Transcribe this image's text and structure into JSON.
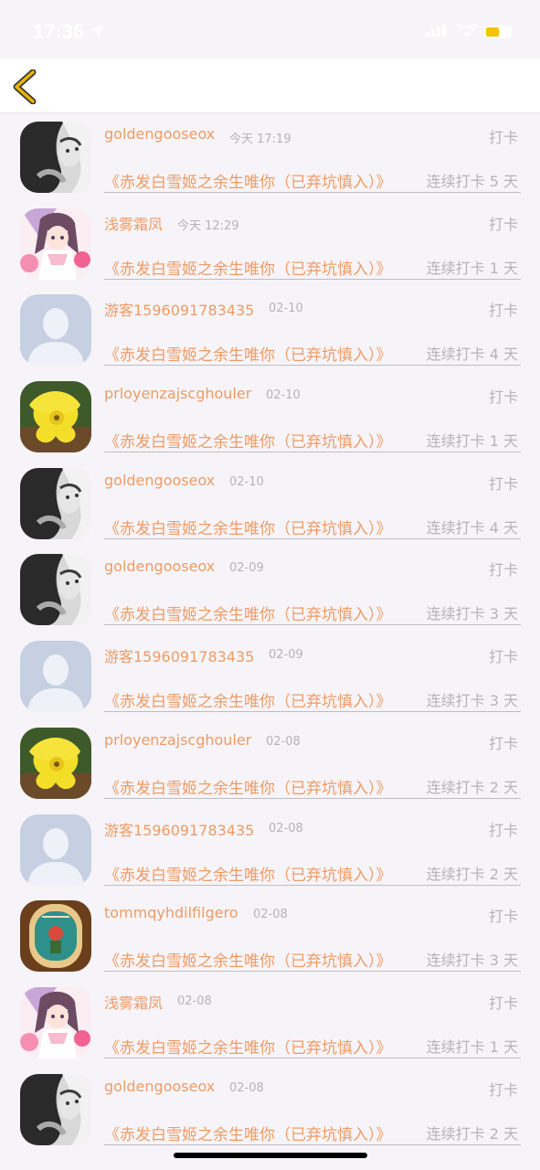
{
  "status_bar": {
    "time": "17:36"
  },
  "nav": {
    "back_icon": "chevron-left-icon",
    "accent_color": "#e8b400"
  },
  "colors": {
    "username": "#ee9b65",
    "meta": "#b4b4b8"
  },
  "entries": [
    {
      "username": "goldengooseox",
      "time": "今天 17:19",
      "action": "打卡",
      "book": "《赤发白雪姬之余生唯你（已弃坑慎入）》",
      "streak": "连续打卡 5 天",
      "avatar": "bw-girl"
    },
    {
      "username": "浅雾霜凤",
      "time": "今天 12:29",
      "action": "打卡",
      "book": "《赤发白雪姬之余生唯你（已弃坑慎入）》",
      "streak": "连续打卡 1 天",
      "avatar": "anime-girl"
    },
    {
      "username": "游客1596091783435",
      "time": "02-10",
      "action": "打卡",
      "book": "《赤发白雪姬之余生唯你（已弃坑慎入）》",
      "streak": "连续打卡 4 天",
      "avatar": "default-user"
    },
    {
      "username": "prloyenzajscghouler",
      "time": "02-10",
      "action": "打卡",
      "book": "《赤发白雪姬之余生唯你（已弃坑慎入）》",
      "streak": "连续打卡 1 天",
      "avatar": "yellow-flower"
    },
    {
      "username": "goldengooseox",
      "time": "02-10",
      "action": "打卡",
      "book": "《赤发白雪姬之余生唯你（已弃坑慎入）》",
      "streak": "连续打卡 4 天",
      "avatar": "bw-girl"
    },
    {
      "username": "goldengooseox",
      "time": "02-09",
      "action": "打卡",
      "book": "《赤发白雪姬之余生唯你（已弃坑慎入）》",
      "streak": "连续打卡 3 天",
      "avatar": "bw-girl"
    },
    {
      "username": "游客1596091783435",
      "time": "02-09",
      "action": "打卡",
      "book": "《赤发白雪姬之余生唯你（已弃坑慎入）》",
      "streak": "连续打卡 3 天",
      "avatar": "default-user"
    },
    {
      "username": "prloyenzajscghouler",
      "time": "02-08",
      "action": "打卡",
      "book": "《赤发白雪姬之余生唯你（已弃坑慎入）》",
      "streak": "连续打卡 2 天",
      "avatar": "yellow-flower"
    },
    {
      "username": "游客1596091783435",
      "time": "02-08",
      "action": "打卡",
      "book": "《赤发白雪姬之余生唯你（已弃坑慎入）》",
      "streak": "连续打卡 2 天",
      "avatar": "default-user"
    },
    {
      "username": "tommqyhdilfilgero",
      "time": "02-08",
      "action": "打卡",
      "book": "《赤发白雪姬之余生唯你（已弃坑慎入）》",
      "streak": "连续打卡 3 天",
      "avatar": "vintage-badge"
    },
    {
      "username": "浅雾霜凤",
      "time": "02-08",
      "action": "打卡",
      "book": "《赤发白雪姬之余生唯你（已弃坑慎入）》",
      "streak": "连续打卡 1 天",
      "avatar": "anime-girl"
    },
    {
      "username": "goldengooseox",
      "time": "02-08",
      "action": "打卡",
      "book": "《赤发白雪姬之余生唯你（已弃坑慎入）》",
      "streak": "连续打卡 2 天",
      "avatar": "bw-girl"
    }
  ]
}
